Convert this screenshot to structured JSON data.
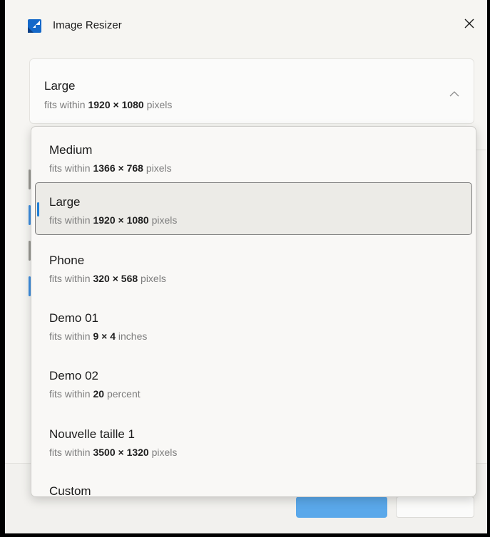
{
  "window": {
    "title": "Image Resizer",
    "accent_color": "#1f7fd6",
    "primary_button_color": "#5aa8ea"
  },
  "icons": {
    "app": "image-resizer-app-icon",
    "close": "close-icon",
    "chevron": "chevron-up-icon",
    "selection": "selection-indicator"
  },
  "size_selector": {
    "selected": {
      "name": "Large",
      "prefix": "fits within",
      "dims": "1920 × 1080",
      "unit": "pixels"
    },
    "options": [
      {
        "name": "Medium",
        "prefix": "fits within",
        "dims": "1366 × 768",
        "unit": "pixels"
      },
      {
        "name": "Large",
        "prefix": "fits within",
        "dims": "1920 × 1080",
        "unit": "pixels",
        "selected": true
      },
      {
        "name": "Phone",
        "prefix": "fits within",
        "dims": "320 × 568",
        "unit": "pixels"
      },
      {
        "name": "Demo 01",
        "prefix": "fits within",
        "dims": "9 × 4",
        "unit": "inches"
      },
      {
        "name": "Demo 02",
        "prefix": "fits within",
        "dims": "20",
        "unit": "percent"
      },
      {
        "name": "Nouvelle taille 1",
        "prefix": "fits within",
        "dims": "3500 × 1320",
        "unit": "pixels"
      }
    ],
    "custom_label": "Custom"
  }
}
